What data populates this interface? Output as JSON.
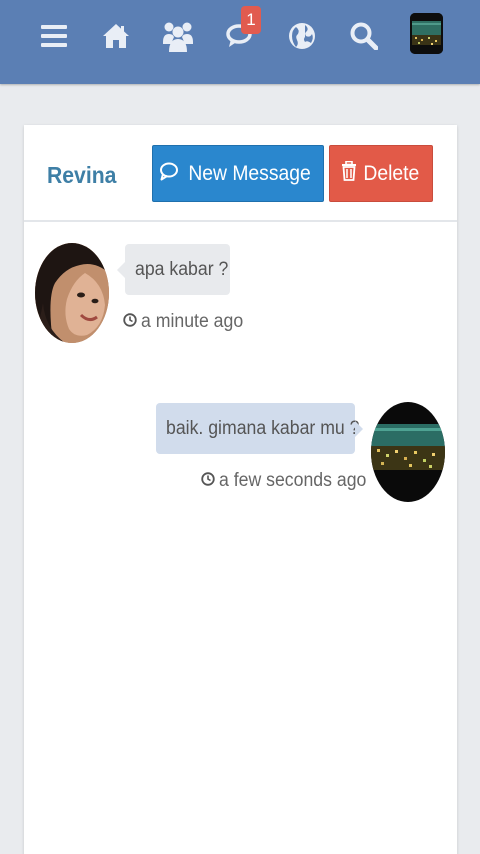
{
  "nav": {
    "icons": [
      "menu-icon",
      "home-icon",
      "group-icon",
      "chat-icon",
      "globe-icon",
      "search-icon",
      "user-avatar"
    ],
    "notification_count": "1"
  },
  "conversation": {
    "contact_name": "Revina",
    "new_message_label": "New Message",
    "delete_label": "Delete"
  },
  "messages": [
    {
      "direction": "incoming",
      "text": "apa kabar ?",
      "time": "a minute ago"
    },
    {
      "direction": "outgoing",
      "text": "baik. gimana kabar mu ?",
      "time": "a few seconds ago"
    }
  ],
  "colors": {
    "topbar": "#5b7fb4",
    "primary_button": "#2a87ce",
    "danger_button": "#e25a48",
    "contact_name": "#3e7fa6",
    "badge": "#e15b4f"
  }
}
